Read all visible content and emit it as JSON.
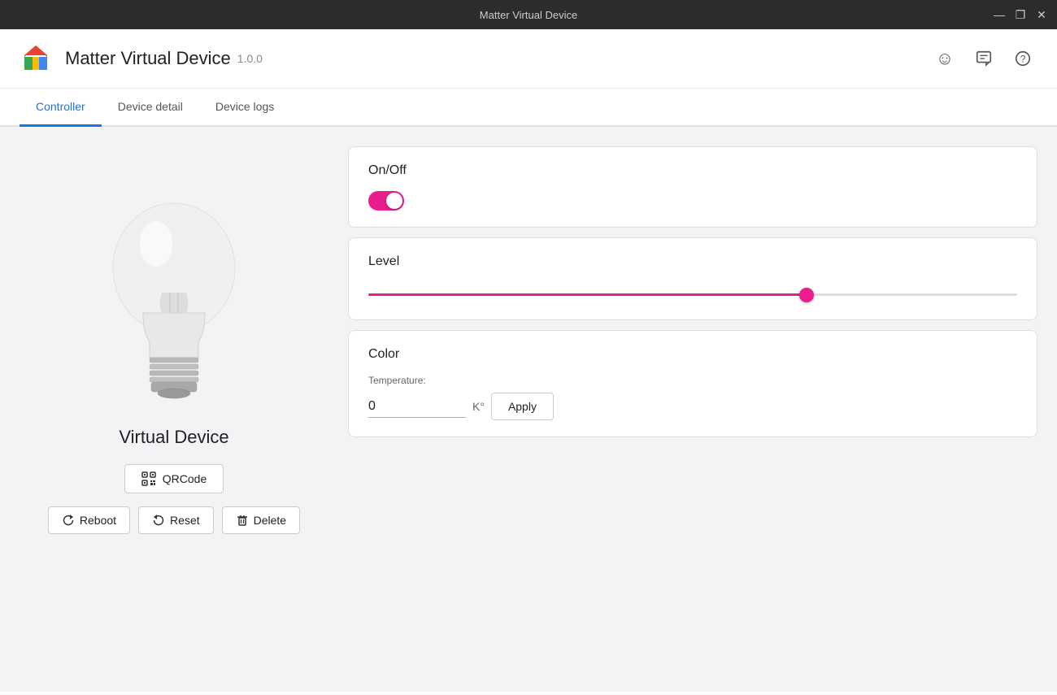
{
  "titlebar": {
    "title": "Matter Virtual Device",
    "minimize_label": "—",
    "restore_label": "❐",
    "close_label": "✕"
  },
  "header": {
    "app_title": "Matter Virtual Device",
    "app_version": "1.0.0",
    "emoji_icon": "☺",
    "feedback_icon": "⚠",
    "help_icon": "?"
  },
  "tabs": [
    {
      "id": "controller",
      "label": "Controller",
      "active": true
    },
    {
      "id": "device-detail",
      "label": "Device detail",
      "active": false
    },
    {
      "id": "device-logs",
      "label": "Device logs",
      "active": false
    }
  ],
  "device": {
    "name": "Virtual Device",
    "qrcode_label": "QRCode",
    "reboot_label": "Reboot",
    "reset_label": "Reset",
    "delete_label": "Delete"
  },
  "controls": {
    "onoff": {
      "label": "On/Off",
      "enabled": true
    },
    "level": {
      "label": "Level",
      "value": 68,
      "min": 0,
      "max": 100
    },
    "color": {
      "label": "Color",
      "temp_label": "Temperature:",
      "temp_value": "0",
      "temp_unit": "K°",
      "apply_label": "Apply"
    }
  }
}
